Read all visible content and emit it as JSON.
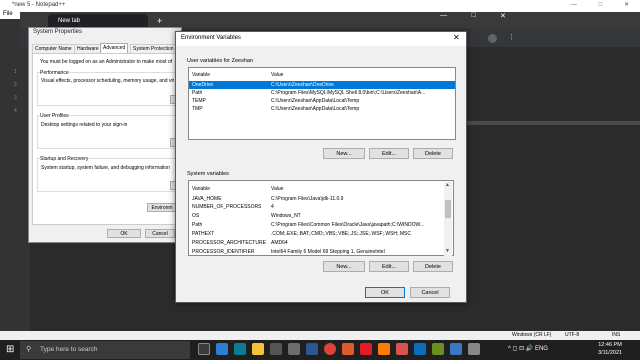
{
  "notepad": {
    "title": "*new 5 - Notepad++",
    "menu_first": "File",
    "controls": [
      "—",
      "□",
      "✕"
    ],
    "line_numbers": [
      "1",
      "2",
      "3",
      "4"
    ],
    "status": {
      "encoding_eol": "Windows (CR LF)",
      "encoding": "UTF-8",
      "mode": "INS"
    }
  },
  "browser": {
    "tab_label": "New tab",
    "plus": "+",
    "controls": [
      "—",
      "□",
      "✕"
    ],
    "menu": "⋮"
  },
  "system_properties": {
    "title": "System Properties",
    "tabs": [
      "Computer Name",
      "Hardware",
      "Advanced",
      "System Protection"
    ],
    "admin_note": "You must be logged on as an Administrator to make most of",
    "performance": {
      "heading": "Performance",
      "text": "Visual effects, processor scheduling, memory usage, and vir"
    },
    "user_profiles": {
      "heading": "User Profiles",
      "text": "Desktop settings related to your sign-in"
    },
    "startup": {
      "heading": "Startup and Recovery",
      "text": "System startup, system failure, and debugging information"
    },
    "env_button": "Environm",
    "ok": "OK",
    "cancel": "Cancel"
  },
  "env_dialog": {
    "title": "Environment Variables",
    "close": "✕",
    "user_section": "User variables for Zeeshan",
    "system_section": "System variables",
    "col_variable": "Variable",
    "col_value": "Value",
    "user_vars": [
      {
        "name": "OneDrive",
        "value": "C:\\Users\\Zeeshan\\OneDrive"
      },
      {
        "name": "Path",
        "value": "C:\\Program Files\\MySQL\\MySQL Shell 8.0\\bin\\;C:\\Users\\Zeeshan\\A..."
      },
      {
        "name": "TEMP",
        "value": "C:\\Users\\Zeeshan\\AppData\\Local\\Temp"
      },
      {
        "name": "TMP",
        "value": "C:\\Users\\Zeeshan\\AppData\\Local\\Temp"
      }
    ],
    "system_vars": [
      {
        "name": "JAVA_HOME",
        "value": "C:\\Program Files\\Java\\jdk-11.0.9"
      },
      {
        "name": "NUMBER_OF_PROCESSORS",
        "value": "4"
      },
      {
        "name": "OS",
        "value": "Windows_NT"
      },
      {
        "name": "Path",
        "value": "C:\\Program Files\\Common Files\\Oracle\\Java\\javapath;C:\\WINDOW..."
      },
      {
        "name": "PATHEXT",
        "value": ".COM;.EXE;.BAT;.CMD;.VBS;.VBE;.JS;.JSE;.WSF;.WSH;.MSC"
      },
      {
        "name": "PROCESSOR_ARCHITECTURE",
        "value": "AMD64"
      },
      {
        "name": "PROCESSOR_IDENTIFIER",
        "value": "Intel64 Family 6 Model 69 Stepping 1, GenuineIntel"
      }
    ],
    "buttons": {
      "new": "New...",
      "edit": "Edit...",
      "delete": "Delete",
      "ok": "OK",
      "cancel": "Cancel"
    }
  },
  "taskbar": {
    "search_placeholder": "Type here to search",
    "time": "12:46 PM",
    "date": "3/11/2021",
    "tray": "^ ◻ ⊡ 🔊 ENG"
  },
  "colors": {
    "selection": "#0078d7",
    "taskbar": "#1f1f1f"
  }
}
